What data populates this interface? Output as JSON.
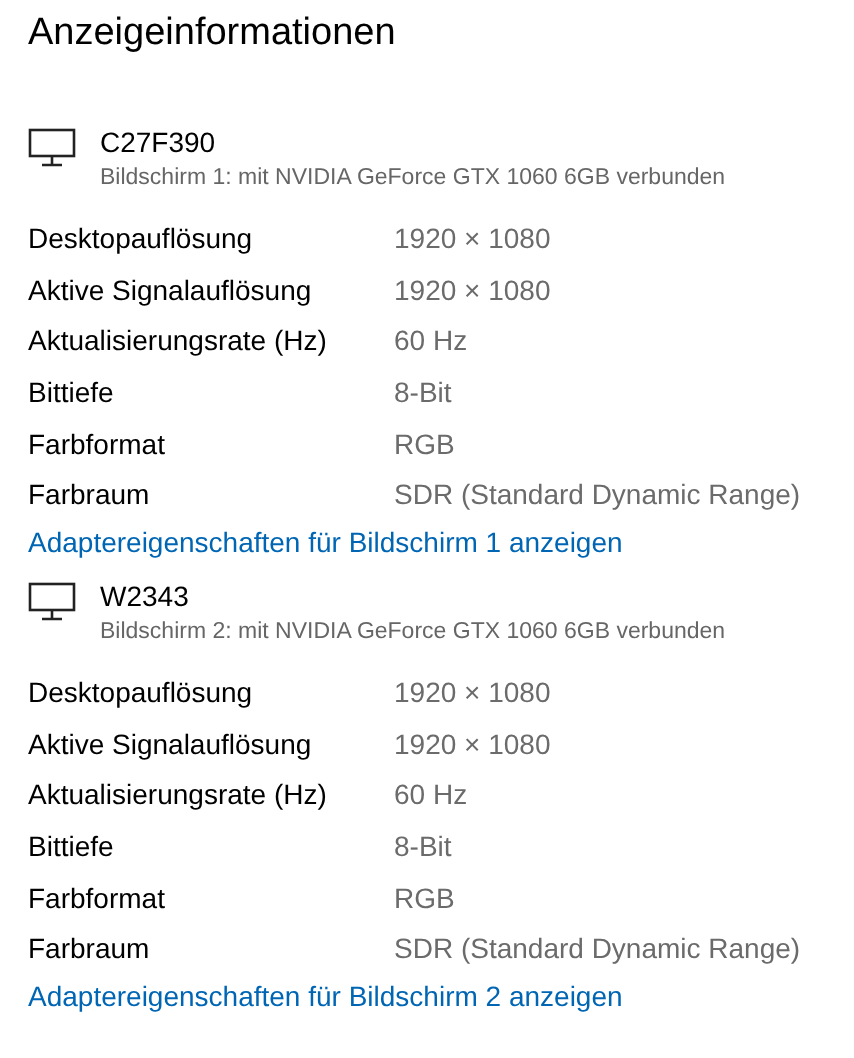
{
  "title": "Anzeigeinformationen",
  "displays": [
    {
      "name": "C27F390",
      "subtitle": "Bildschirm 1: mit NVIDIA GeForce GTX 1060 6GB verbunden",
      "rows": [
        {
          "label": "Desktopauflösung",
          "value": "1920 × 1080"
        },
        {
          "label": "Aktive Signalauflösung",
          "value": "1920 × 1080"
        },
        {
          "label": "Aktualisierungsrate (Hz)",
          "value": "60 Hz"
        },
        {
          "label": "Bittiefe",
          "value": "8-Bit"
        },
        {
          "label": "Farbformat",
          "value": "RGB"
        },
        {
          "label": "Farbraum",
          "value": "SDR (Standard Dynamic Range)"
        }
      ],
      "link": "Adaptereigenschaften für Bildschirm 1 anzeigen"
    },
    {
      "name": "W2343",
      "subtitle": "Bildschirm 2: mit NVIDIA GeForce GTX 1060 6GB verbunden",
      "rows": [
        {
          "label": "Desktopauflösung",
          "value": "1920 × 1080"
        },
        {
          "label": "Aktive Signalauflösung",
          "value": "1920 × 1080"
        },
        {
          "label": "Aktualisierungsrate (Hz)",
          "value": "60 Hz"
        },
        {
          "label": "Bittiefe",
          "value": "8-Bit"
        },
        {
          "label": "Farbformat",
          "value": "RGB"
        },
        {
          "label": "Farbraum",
          "value": "SDR (Standard Dynamic Range)"
        }
      ],
      "link": "Adaptereigenschaften für Bildschirm 2 anzeigen"
    }
  ]
}
